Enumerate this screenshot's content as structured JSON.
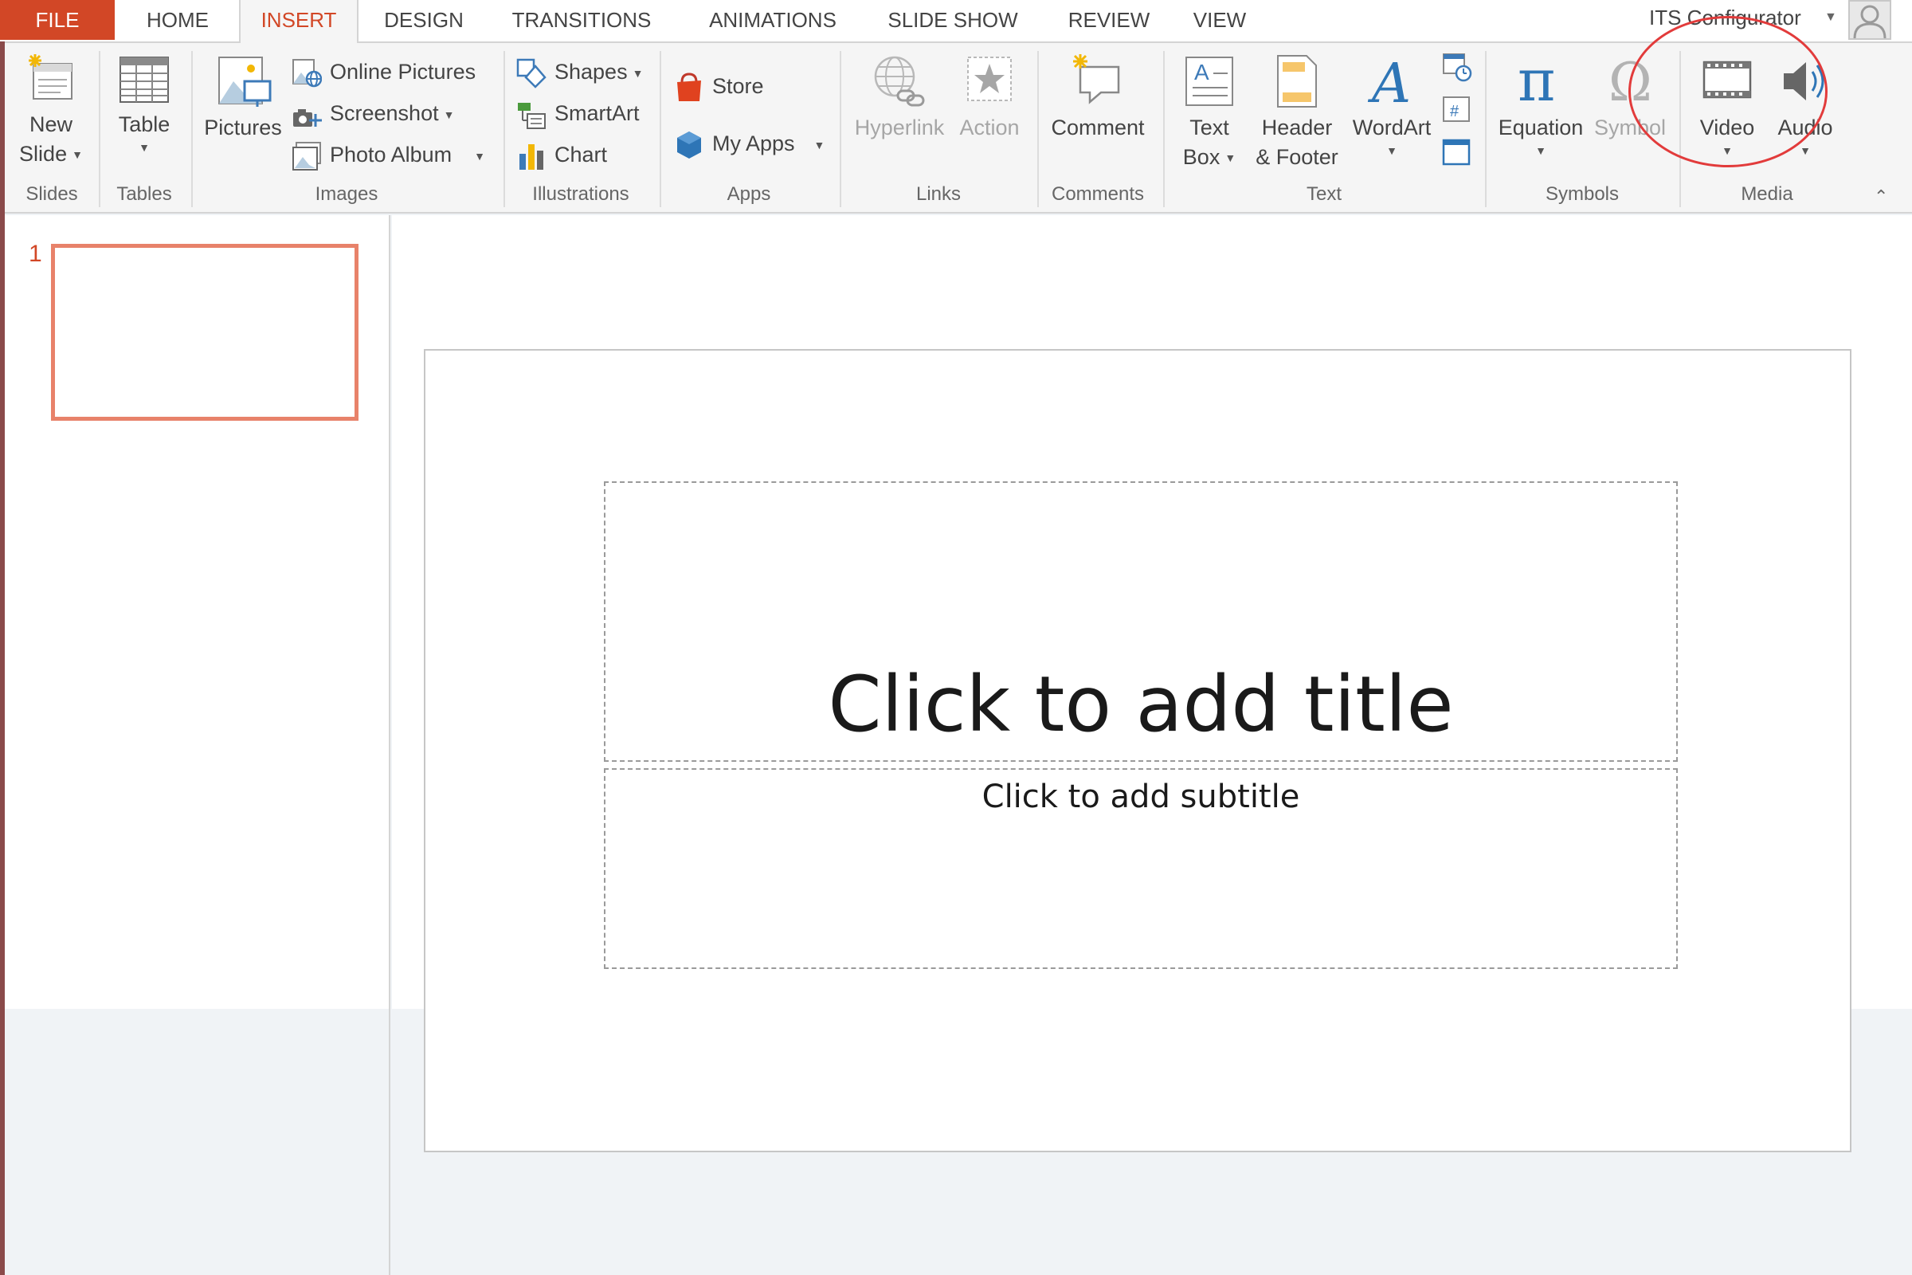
{
  "tabs": {
    "file": "FILE",
    "home": "HOME",
    "insert": "INSERT",
    "design": "DESIGN",
    "transitions": "TRANSITIONS",
    "animations": "ANIMATIONS",
    "slideshow": "SLIDE SHOW",
    "review": "REVIEW",
    "view": "VIEW",
    "active": "INSERT"
  },
  "account": {
    "name": "ITS Configurator"
  },
  "ribbon": {
    "groups": {
      "slides": "Slides",
      "tables": "Tables",
      "images": "Images",
      "illustrations": "Illustrations",
      "apps": "Apps",
      "links": "Links",
      "comments": "Comments",
      "text": "Text",
      "symbols": "Symbols",
      "media": "Media"
    },
    "new_slide": {
      "line1": "New",
      "line2": "Slide"
    },
    "table": "Table",
    "pictures": "Pictures",
    "online_pictures": "Online Pictures",
    "screenshot": "Screenshot",
    "photo_album": "Photo Album",
    "shapes": "Shapes",
    "smartart": "SmartArt",
    "chart": "Chart",
    "store": "Store",
    "my_apps": "My Apps",
    "hyperlink": "Hyperlink",
    "action": "Action",
    "comment": "Comment",
    "text_box": {
      "line1": "Text",
      "line2": "Box"
    },
    "header_footer": {
      "line1": "Header",
      "line2": "& Footer"
    },
    "wordart": "WordArt",
    "equation": "Equation",
    "symbol": "Symbol",
    "video": "Video",
    "audio": "Audio"
  },
  "thumbnails": {
    "slide_number": "1"
  },
  "slide": {
    "title_placeholder": "Click to add title",
    "subtitle_placeholder": "Click to add subtitle"
  },
  "colors": {
    "accent": "#d24726",
    "thumb_border": "#e8826a",
    "annotation": "#e23b3b"
  },
  "annotation": {
    "highlighted_group": "Media",
    "shape": "ellipse"
  }
}
